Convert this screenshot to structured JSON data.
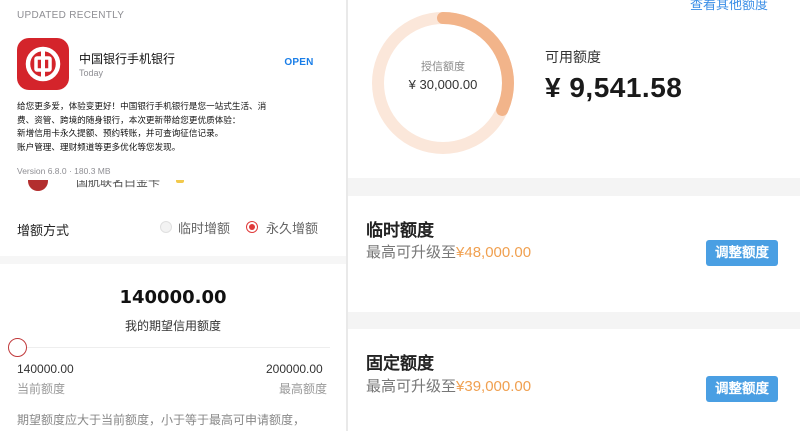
{
  "app_store": {
    "section_label": "UPDATED RECENTLY",
    "app_name": "中国银行手机银行",
    "date": "Today",
    "open_label": "OPEN",
    "description_lines": [
      "给您更多爱，体验变更好！中国银行手机银行是您一站式生活、消",
      "费、资管、跨境的随身银行，本次更新带给您更优质体验：",
      "新增信用卡永久提额、预约转账，并可查询征信记录。",
      "账户管理、理财频道等更多优化等您发现。"
    ],
    "version_info": "Version 6.8.0 · 180.3 MB",
    "brand_color": "#d4242b"
  },
  "partial_card_text": "国航联名白金卡",
  "increase": {
    "label": "增额方式",
    "option_temporary": "临时增额",
    "option_permanent": "永久增额",
    "selected": "永久增额"
  },
  "expected": {
    "value": "140000.00",
    "label": "我的期望信用额度",
    "slider_fraction": 0.0,
    "current_value": "140000.00",
    "current_label": "当前额度",
    "max_value": "200000.00",
    "max_label": "最高额度",
    "note": "期望额度应大于当前额度，小于等于最高可申请额度，"
  },
  "credit": {
    "top_link": "查看其他额度",
    "granted_label": "授信额度",
    "granted_value": "¥ 30,000.00",
    "available_label": "可用额度",
    "available_value": "¥ 9,541.58",
    "available_fraction": 0.318,
    "ring_color": "#f2b48a",
    "ring_track_color": "#fbe7da"
  },
  "temporary": {
    "title": "临时额度",
    "sub_prefix": "最高可升级至",
    "sub_amount": "¥48,000.00",
    "button": "调整额度"
  },
  "fixed": {
    "title": "固定额度",
    "sub_prefix": "最高可升级至",
    "sub_amount": "¥39,000.00",
    "button": "调整额度"
  },
  "colors": {
    "accent_blue": "#4a9fe3",
    "amount_orange": "#f0a050",
    "radio_red": "#e03a3a"
  }
}
